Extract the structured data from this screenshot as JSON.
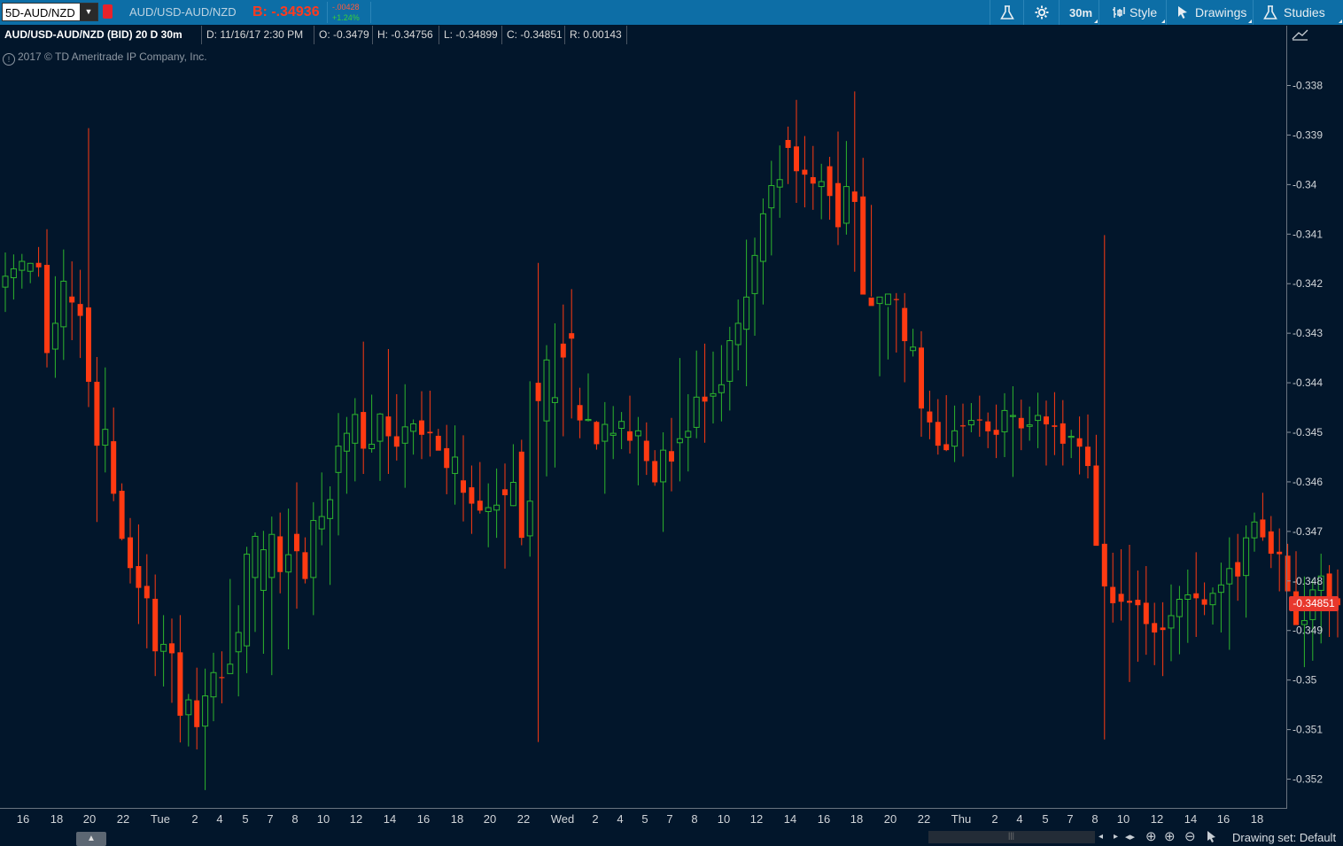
{
  "toolbar": {
    "symbol": "5D-AUD/NZD",
    "description": "AUD/USD-AUD/NZD",
    "bid": "B: -.34936",
    "change_abs": "-.00428",
    "change_pct": "+1.24%",
    "timeframe": "30m",
    "style_label": "Style",
    "drawings_label": "Drawings",
    "studies_label": "Studies"
  },
  "infobar": {
    "title": "AUD/USD-AUD/NZD (BID) 20 D 30m",
    "date": "D: 11/16/17 2:30 PM",
    "open": "O: -0.3479",
    "high": "H: -0.34756",
    "low": "L: -0.34899",
    "close": "C: -0.34851",
    "range": "R: 0.00143"
  },
  "copyright": "2017 © TD Ameritrade IP Company, Inc.",
  "last_price": "-0.34851",
  "drawing_set": "Drawing set: Default",
  "colors": {
    "up": "#2db52d",
    "down": "#ff3a12",
    "background": "#02162b",
    "toolbar": "#0d6ea6"
  },
  "chart_data": {
    "type": "candlestick",
    "ylim": [
      -0.3525,
      -0.3377
    ],
    "yticks": [
      -0.338,
      -0.339,
      -0.34,
      -0.341,
      -0.342,
      -0.343,
      -0.344,
      -0.345,
      -0.346,
      -0.347,
      -0.348,
      -0.349,
      -0.35,
      -0.351,
      -0.352
    ],
    "ytick_labels": [
      "-0.338",
      "-0.339",
      "-0.34",
      "-0.341",
      "-0.342",
      "-0.343",
      "-0.344",
      "-0.345",
      "-0.346",
      "-0.347",
      "-0.348",
      "-0.349",
      "-0.35",
      "-0.351",
      "-0.352"
    ],
    "xtick_labels": [
      "16",
      "18",
      "20",
      "22",
      "Tue",
      "2",
      "4",
      "5",
      "7",
      "8",
      "10",
      "12",
      "14",
      "16",
      "18",
      "20",
      "22",
      "Wed",
      "2",
      "4",
      "5",
      "7",
      "8",
      "10",
      "12",
      "14",
      "16",
      "18",
      "20",
      "22",
      "Thu",
      "2",
      "4",
      "5",
      "7",
      "8",
      "10",
      "12",
      "14",
      "16",
      "18"
    ],
    "candles": [
      [
        -0.34207,
        -0.34137,
        -0.34257,
        -0.34185
      ],
      [
        -0.34188,
        -0.34141,
        -0.34232,
        -0.3417
      ],
      [
        -0.34173,
        -0.3414,
        -0.3421,
        -0.34155
      ],
      [
        -0.34175,
        -0.34158,
        -0.34199,
        -0.34159
      ],
      [
        -0.34158,
        -0.34126,
        -0.34186,
        -0.34167
      ],
      [
        -0.34162,
        -0.3409,
        -0.34369,
        -0.3434
      ],
      [
        -0.34332,
        -0.34185,
        -0.3439,
        -0.3428
      ],
      [
        -0.34287,
        -0.34131,
        -0.34354,
        -0.34195
      ],
      [
        -0.34226,
        -0.34155,
        -0.34314,
        -0.34238
      ],
      [
        -0.34241,
        -0.34172,
        -0.3435,
        -0.34265
      ],
      [
        -0.34248,
        -0.33886,
        -0.34449,
        -0.34398
      ],
      [
        -0.34398,
        -0.34348,
        -0.34681,
        -0.34527
      ],
      [
        -0.34526,
        -0.34369,
        -0.34581,
        -0.34494
      ],
      [
        -0.34518,
        -0.3445,
        -0.34639,
        -0.34624
      ],
      [
        -0.34618,
        -0.34603,
        -0.34718,
        -0.34715
      ],
      [
        -0.34712,
        -0.34673,
        -0.34805,
        -0.34774
      ],
      [
        -0.3477,
        -0.34686,
        -0.34887,
        -0.34814
      ],
      [
        -0.3481,
        -0.34746,
        -0.34936,
        -0.34835
      ],
      [
        -0.34836,
        -0.34787,
        -0.34992,
        -0.34942
      ],
      [
        -0.34942,
        -0.34869,
        -0.35013,
        -0.34928
      ],
      [
        -0.34926,
        -0.34876,
        -0.35046,
        -0.34946
      ],
      [
        -0.34944,
        -0.34869,
        -0.35126,
        -0.35072
      ],
      [
        -0.3507,
        -0.35028,
        -0.35134,
        -0.3504
      ],
      [
        -0.35041,
        -0.34975,
        -0.3514,
        -0.35095
      ],
      [
        -0.35093,
        -0.34977,
        -0.35222,
        -0.35032
      ],
      [
        -0.35034,
        -0.34945,
        -0.35083,
        -0.34985
      ],
      [
        -0.34994,
        -0.34942,
        -0.35047,
        -0.34994
      ],
      [
        -0.34987,
        -0.34796,
        -0.34987,
        -0.34968
      ],
      [
        -0.34943,
        -0.34849,
        -0.35033,
        -0.34904
      ],
      [
        -0.34931,
        -0.34731,
        -0.34986,
        -0.34746
      ],
      [
        -0.34793,
        -0.34702,
        -0.34903,
        -0.3471
      ],
      [
        -0.34819,
        -0.34699,
        -0.34947,
        -0.34737
      ],
      [
        -0.34793,
        -0.3467,
        -0.3499,
        -0.34706
      ],
      [
        -0.3471,
        -0.34662,
        -0.34825,
        -0.34782
      ],
      [
        -0.34782,
        -0.34654,
        -0.34938,
        -0.34747
      ],
      [
        -0.34705,
        -0.34601,
        -0.34856,
        -0.3474
      ],
      [
        -0.34742,
        -0.34712,
        -0.34805,
        -0.34796
      ],
      [
        -0.34793,
        -0.34641,
        -0.34869,
        -0.34678
      ],
      [
        -0.34695,
        -0.34581,
        -0.34728,
        -0.3467
      ],
      [
        -0.34674,
        -0.34609,
        -0.34808,
        -0.34636
      ],
      [
        -0.34581,
        -0.34461,
        -0.34708,
        -0.34528
      ],
      [
        -0.34538,
        -0.34469,
        -0.34624,
        -0.34502
      ],
      [
        -0.34522,
        -0.34431,
        -0.34599,
        -0.34464
      ],
      [
        -0.34459,
        -0.34317,
        -0.34584,
        -0.34533
      ],
      [
        -0.34533,
        -0.34424,
        -0.34541,
        -0.34524
      ],
      [
        -0.34518,
        -0.34461,
        -0.34598,
        -0.34463
      ],
      [
        -0.34468,
        -0.34332,
        -0.34584,
        -0.34508
      ],
      [
        -0.34508,
        -0.34423,
        -0.34557,
        -0.34529
      ],
      [
        -0.34522,
        -0.34403,
        -0.34612,
        -0.34489
      ],
      [
        -0.34498,
        -0.34474,
        -0.34545,
        -0.34483
      ],
      [
        -0.34476,
        -0.34417,
        -0.34554,
        -0.34505
      ],
      [
        -0.34499,
        -0.34416,
        -0.34549,
        -0.34502
      ],
      [
        -0.34507,
        -0.34493,
        -0.34536,
        -0.34537
      ],
      [
        -0.34532,
        -0.34485,
        -0.34625,
        -0.34572
      ],
      [
        -0.34583,
        -0.34486,
        -0.34646,
        -0.3455
      ],
      [
        -0.34597,
        -0.34506,
        -0.3468,
        -0.34622
      ],
      [
        -0.34611,
        -0.34567,
        -0.34705,
        -0.34644
      ],
      [
        -0.34638,
        -0.3456,
        -0.34664,
        -0.34658
      ],
      [
        -0.3466,
        -0.34603,
        -0.34732,
        -0.34652
      ],
      [
        -0.34657,
        -0.34573,
        -0.34713,
        -0.34647
      ],
      [
        -0.34615,
        -0.34563,
        -0.34775,
        -0.34627
      ],
      [
        -0.34648,
        -0.34524,
        -0.34649,
        -0.34601
      ],
      [
        -0.34539,
        -0.34515,
        -0.34728,
        -0.34713
      ],
      [
        -0.34709,
        -0.34397,
        -0.34751,
        -0.34639
      ],
      [
        -0.344,
        -0.34158,
        -0.35125,
        -0.34437
      ],
      [
        -0.34477,
        -0.34324,
        -0.34589,
        -0.34354
      ],
      [
        -0.3444,
        -0.3428,
        -0.34571,
        -0.3443
      ],
      [
        -0.34321,
        -0.34242,
        -0.34508,
        -0.34349
      ],
      [
        -0.343,
        -0.34211,
        -0.34472,
        -0.34311
      ],
      [
        -0.34445,
        -0.3441,
        -0.34512,
        -0.34476
      ],
      [
        -0.34475,
        -0.34381,
        -0.34478,
        -0.34474
      ],
      [
        -0.34479,
        -0.34477,
        -0.34535,
        -0.34524
      ],
      [
        -0.34518,
        -0.34439,
        -0.34624,
        -0.34484
      ],
      [
        -0.34506,
        -0.34447,
        -0.34554,
        -0.34502
      ],
      [
        -0.34492,
        -0.34459,
        -0.34534,
        -0.34478
      ],
      [
        -0.34498,
        -0.34426,
        -0.34543,
        -0.34517
      ],
      [
        -0.34507,
        -0.34469,
        -0.34607,
        -0.34497
      ],
      [
        -0.34517,
        -0.3448,
        -0.34586,
        -0.34558
      ],
      [
        -0.34558,
        -0.34536,
        -0.34608,
        -0.34601
      ],
      [
        -0.346,
        -0.345,
        -0.34701,
        -0.34536
      ],
      [
        -0.34538,
        -0.34471,
        -0.34619,
        -0.34559
      ],
      [
        -0.34521,
        -0.3435,
        -0.34599,
        -0.34513
      ],
      [
        -0.3451,
        -0.34423,
        -0.34579,
        -0.34498
      ],
      [
        -0.3449,
        -0.34335,
        -0.34512,
        -0.34429
      ],
      [
        -0.34428,
        -0.34321,
        -0.34521,
        -0.34438
      ],
      [
        -0.34427,
        -0.34337,
        -0.34482,
        -0.34422
      ],
      [
        -0.3442,
        -0.34324,
        -0.34478,
        -0.34404
      ],
      [
        -0.34397,
        -0.34287,
        -0.34456,
        -0.34315
      ],
      [
        -0.34323,
        -0.34232,
        -0.34375,
        -0.3428
      ],
      [
        -0.34292,
        -0.34111,
        -0.34407,
        -0.34227
      ],
      [
        -0.3422,
        -0.34107,
        -0.34305,
        -0.34143
      ],
      [
        -0.34155,
        -0.34028,
        -0.34242,
        -0.34059
      ],
      [
        -0.34047,
        -0.33952,
        -0.34143,
        -0.34002
      ],
      [
        -0.34005,
        -0.33921,
        -0.34067,
        -0.3399
      ],
      [
        -0.3391,
        -0.33883,
        -0.33999,
        -0.33926
      ],
      [
        -0.33923,
        -0.33829,
        -0.34037,
        -0.33973
      ],
      [
        -0.3397,
        -0.33902,
        -0.34046,
        -0.3398
      ],
      [
        -0.33985,
        -0.33922,
        -0.34051,
        -0.33998
      ],
      [
        -0.34004,
        -0.33958,
        -0.3407,
        -0.33994
      ],
      [
        -0.33963,
        -0.33944,
        -0.34071,
        -0.34023
      ],
      [
        -0.33997,
        -0.33893,
        -0.34122,
        -0.34086
      ],
      [
        -0.34078,
        -0.33912,
        -0.34101,
        -0.34004
      ],
      [
        -0.34014,
        -0.33812,
        -0.34176,
        -0.34035
      ],
      [
        -0.34024,
        -0.33946,
        -0.34146,
        -0.34222
      ],
      [
        -0.34228,
        -0.34041,
        -0.34226,
        -0.34245
      ],
      [
        -0.3424,
        -0.34235,
        -0.34387,
        -0.34227
      ],
      [
        -0.34242,
        -0.34247,
        -0.34353,
        -0.34221
      ],
      [
        -0.34231,
        -0.34219,
        -0.34339,
        -0.34232
      ],
      [
        -0.34249,
        -0.34219,
        -0.34399,
        -0.34316
      ],
      [
        -0.34335,
        -0.34291,
        -0.34347,
        -0.34328
      ],
      [
        -0.34329,
        -0.34296,
        -0.34509,
        -0.34452
      ],
      [
        -0.34458,
        -0.34416,
        -0.34514,
        -0.3448
      ],
      [
        -0.34479,
        -0.34433,
        -0.34545,
        -0.34527
      ],
      [
        -0.34524,
        -0.34425,
        -0.34538,
        -0.34536
      ],
      [
        -0.34528,
        -0.34446,
        -0.3456,
        -0.34497
      ],
      [
        -0.34486,
        -0.34442,
        -0.34549,
        -0.34486
      ],
      [
        -0.34485,
        -0.34441,
        -0.345,
        -0.34476
      ],
      [
        -0.34474,
        -0.34426,
        -0.34509,
        -0.34475
      ],
      [
        -0.34478,
        -0.3446,
        -0.34532,
        -0.34498
      ],
      [
        -0.34495,
        -0.34444,
        -0.34552,
        -0.34505
      ],
      [
        -0.34499,
        -0.34421,
        -0.3455,
        -0.34456
      ],
      [
        -0.34468,
        -0.34407,
        -0.3459,
        -0.34466
      ],
      [
        -0.34471,
        -0.34434,
        -0.34536,
        -0.34492
      ],
      [
        -0.34488,
        -0.34448,
        -0.34517,
        -0.34485
      ],
      [
        -0.34476,
        -0.3442,
        -0.34532,
        -0.34466
      ],
      [
        -0.34468,
        -0.34436,
        -0.34567,
        -0.34484
      ],
      [
        -0.34486,
        -0.34419,
        -0.34546,
        -0.34489
      ],
      [
        -0.34482,
        -0.34435,
        -0.34567,
        -0.34523
      ],
      [
        -0.34509,
        -0.34495,
        -0.34552,
        -0.34508
      ],
      [
        -0.34512,
        -0.34468,
        -0.34585,
        -0.34529
      ],
      [
        -0.34529,
        -0.34464,
        -0.34593,
        -0.34568
      ],
      [
        -0.34567,
        -0.34505,
        -0.3463,
        -0.34729
      ],
      [
        -0.34725,
        -0.34102,
        -0.3512,
        -0.34811
      ],
      [
        -0.34812,
        -0.34743,
        -0.34884,
        -0.34845
      ],
      [
        -0.34826,
        -0.34736,
        -0.3488,
        -0.34842
      ],
      [
        -0.3484,
        -0.34727,
        -0.35004,
        -0.34844
      ],
      [
        -0.34838,
        -0.34779,
        -0.34963,
        -0.34849
      ],
      [
        -0.34844,
        -0.3477,
        -0.34949,
        -0.34887
      ],
      [
        -0.34885,
        -0.34844,
        -0.3497,
        -0.34904
      ],
      [
        -0.34894,
        -0.34843,
        -0.34992,
        -0.34899
      ],
      [
        -0.34895,
        -0.34807,
        -0.34962,
        -0.3487
      ],
      [
        -0.34872,
        -0.3481,
        -0.34948,
        -0.34837
      ],
      [
        -0.34837,
        -0.34777,
        -0.34925,
        -0.34828
      ],
      [
        -0.34825,
        -0.34742,
        -0.34913,
        -0.34835
      ],
      [
        -0.34837,
        -0.34803,
        -0.34869,
        -0.34848
      ],
      [
        -0.34848,
        -0.34813,
        -0.34888,
        -0.34825
      ],
      [
        -0.34823,
        -0.34763,
        -0.34904,
        -0.34808
      ],
      [
        -0.34806,
        -0.34712,
        -0.34939,
        -0.34775
      ],
      [
        -0.34762,
        -0.34705,
        -0.3484,
        -0.34791
      ],
      [
        -0.34789,
        -0.34688,
        -0.34874,
        -0.34713
      ],
      [
        -0.34713,
        -0.34662,
        -0.34741,
        -0.34681
      ],
      [
        -0.34676,
        -0.34622,
        -0.34719,
        -0.34712
      ],
      [
        -0.347,
        -0.34669,
        -0.34774,
        -0.34745
      ],
      [
        -0.34741,
        -0.34694,
        -0.34821,
        -0.34746
      ],
      [
        -0.34749,
        -0.34725,
        -0.34788,
        -0.34821
      ],
      [
        -0.34821,
        -0.3474,
        -0.34873,
        -0.34889
      ],
      [
        -0.34888,
        -0.34791,
        -0.34974,
        -0.3488
      ],
      [
        -0.34878,
        -0.34796,
        -0.34961,
        -0.34818
      ],
      [
        -0.34819,
        -0.34745,
        -0.34926,
        -0.3479
      ],
      [
        -0.34785,
        -0.34768,
        -0.34913,
        -0.34837
      ],
      [
        -0.34835,
        -0.34777,
        -0.34914,
        -0.34849
      ],
      [
        -0.34848,
        -0.34784,
        -0.34919,
        -0.3489
      ],
      [
        -0.3489,
        -0.34812,
        -0.34941,
        -0.34917
      ],
      [
        -0.3492,
        -0.34845,
        -0.35003,
        -0.34931
      ],
      [
        -0.34925,
        -0.34887,
        -0.35002,
        -0.34962
      ],
      [
        -0.34959,
        -0.34914,
        -0.35014,
        -0.34919
      ],
      [
        -0.34918,
        -0.34858,
        -0.35075,
        -0.34937
      ],
      [
        -0.34934,
        -0.34888,
        -0.35028,
        -0.34967
      ],
      [
        -0.34965,
        -0.34918,
        -0.3505,
        -0.35003
      ],
      [
        -0.35003,
        -0.34982,
        -0.35039,
        -0.35038
      ],
      [
        -0.35038,
        -0.3501,
        -0.35083,
        -0.35056
      ],
      [
        -0.35054,
        -0.35013,
        -0.35062,
        -0.3503
      ],
      [
        -0.35033,
        -0.34979,
        -0.35098,
        -0.3506
      ],
      [
        -0.35059,
        -0.35006,
        -0.35106,
        -0.35059
      ],
      [
        -0.3506,
        -0.3501,
        -0.35098,
        -0.35046
      ],
      [
        -0.35042,
        -0.34967,
        -0.35102,
        -0.3493
      ],
      [
        -0.3493,
        -0.3489,
        -0.35051,
        -0.34917
      ],
      [
        -0.34918,
        -0.34843,
        -0.34988,
        -0.34865
      ],
      [
        -0.3486,
        -0.34822,
        -0.34906,
        -0.34816
      ],
      [
        -0.34808,
        -0.34774,
        -0.34902,
        -0.34831
      ],
      [
        -0.34834,
        -0.34805,
        -0.34887,
        -0.34825
      ],
      [
        -0.34819,
        -0.34761,
        -0.34861,
        -0.34808
      ],
      [
        -0.34809,
        -0.34785,
        -0.34823,
        -0.34804
      ],
      [
        -0.34803,
        -0.34786,
        -0.34857,
        -0.34799
      ],
      [
        -0.348,
        -0.34749,
        -0.34826,
        -0.34785
      ],
      [
        -0.34787,
        -0.347,
        -0.34893,
        -0.34764
      ],
      [
        -0.34775,
        -0.34722,
        -0.34848,
        -0.34758
      ],
      [
        -0.34757,
        -0.34728,
        -0.34873,
        -0.34752
      ],
      [
        -0.34754,
        -0.34712,
        -0.34833,
        -0.34839
      ],
      [
        -0.34833,
        -0.34759,
        -0.34881,
        -0.34825
      ],
      [
        -0.34823,
        -0.34749,
        -0.34881,
        -0.34844
      ],
      [
        -0.34847,
        -0.34756,
        -0.34868,
        -0.34841
      ],
      [
        -0.3479,
        -0.34756,
        -0.34899,
        -0.34851
      ]
    ]
  }
}
